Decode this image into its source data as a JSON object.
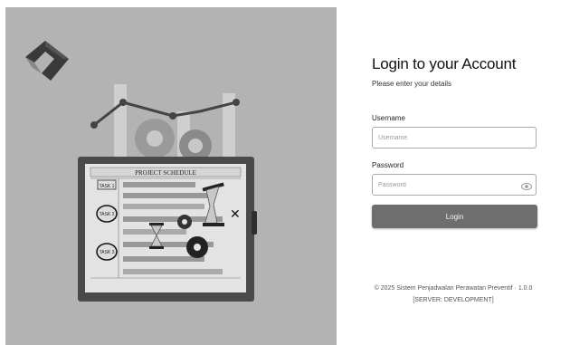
{
  "login": {
    "title": "Login to your Account",
    "subtitle": "Please enter your details",
    "username_label": "Username",
    "username_placeholder": "Username",
    "password_label": "Password",
    "password_placeholder": "Password",
    "login_button": "Login"
  },
  "footer": {
    "copyright": "© 2025 Sistem Penjadwalan Perawatan Preventif · 1.0.0",
    "server": "[SERVER: DEVELOPMENT]"
  },
  "illustration": {
    "board_title": "PROJECT SCHEDULE",
    "task1": "TASK 1",
    "task2": "TASK 2",
    "task3": "TASK 3"
  },
  "colors": {
    "left_panel_bg": "#b3b3b3",
    "button_bg": "#6e6e6e"
  },
  "icons": [
    "logo-icon",
    "eye-icon",
    "gear-icon",
    "hourglass-icon"
  ]
}
